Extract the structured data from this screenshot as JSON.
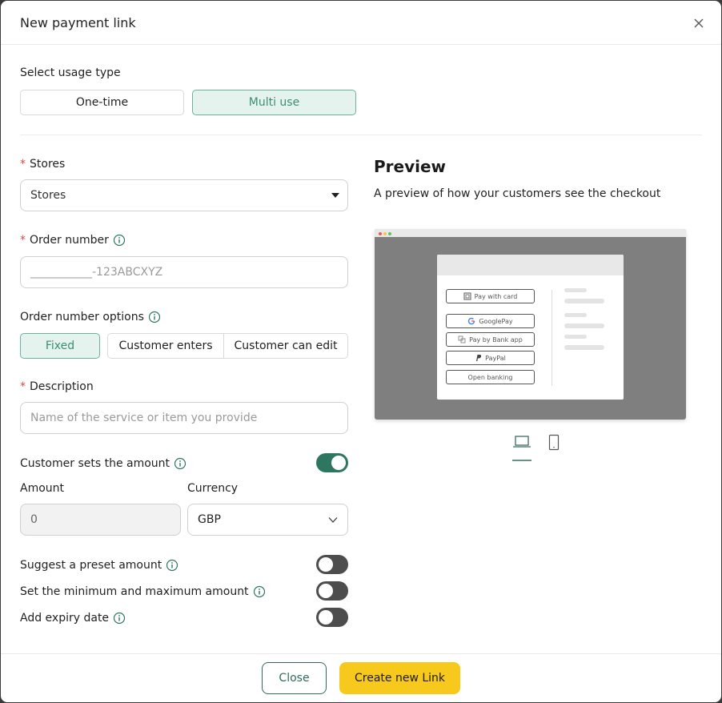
{
  "modal": {
    "title": "New payment link",
    "close_icon": "close-icon"
  },
  "usage": {
    "label": "Select usage type",
    "options": [
      "One-time",
      "Multi use"
    ],
    "selected": "Multi use"
  },
  "stores": {
    "label": "Stores",
    "value": "Stores"
  },
  "order_number": {
    "label": "Order number",
    "placeholder": "___________-123ABCXYZ"
  },
  "order_options": {
    "label": "Order number options",
    "options": [
      "Fixed",
      "Customer enters",
      "Customer can edit"
    ],
    "selected": "Fixed"
  },
  "description": {
    "label": "Description",
    "placeholder": "Name of the service or item you provide"
  },
  "customer_sets_amount": {
    "label": "Customer sets the amount",
    "on": true
  },
  "amount": {
    "label": "Amount",
    "value": "0"
  },
  "currency": {
    "label": "Currency",
    "value": "GBP"
  },
  "toggles": [
    {
      "label": "Suggest a preset amount",
      "on": false
    },
    {
      "label": "Set the minimum and maximum amount",
      "on": false
    },
    {
      "label": "Add expiry date",
      "on": false
    }
  ],
  "preview": {
    "title": "Preview",
    "subtitle": "A preview of how your customers see the checkout",
    "methods": [
      "Pay with card",
      "GooglePay",
      "Pay by Bank app",
      "PayPal",
      "Open banking"
    ],
    "devices": [
      "laptop-icon",
      "phone-icon"
    ],
    "selected_device": "laptop-icon"
  },
  "footer": {
    "close_label": "Close",
    "create_label": "Create new Link"
  },
  "colors": {
    "accent_green": "#2f7660",
    "selected_bg": "#e5f3ef",
    "primary_yellow": "#f7c91c",
    "required": "#e0474b"
  }
}
